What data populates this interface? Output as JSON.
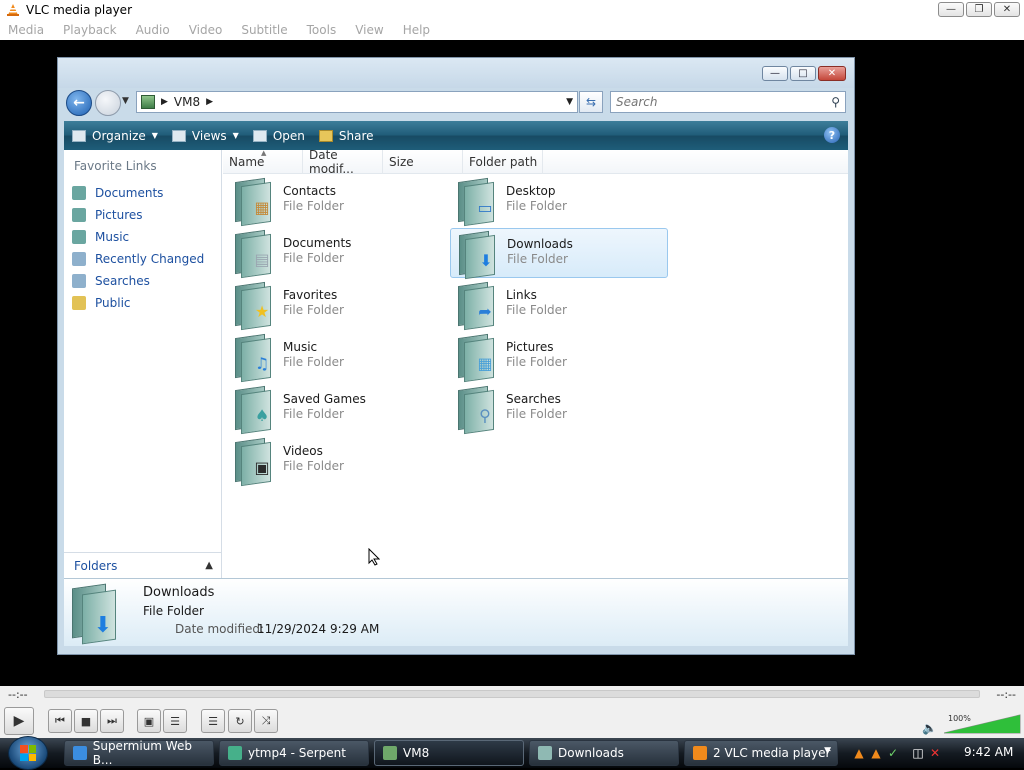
{
  "vlc": {
    "title": "VLC media player",
    "menu": [
      "Media",
      "Playback",
      "Audio",
      "Video",
      "Subtitle",
      "Tools",
      "View",
      "Help"
    ],
    "time_elapsed": "--:--",
    "time_total": "--:--",
    "volume": "100%",
    "volume_level": 1.0
  },
  "explorer": {
    "address": {
      "path_label": "VM8"
    },
    "search": {
      "placeholder": "Search"
    },
    "toolbar": {
      "organize": "Organize",
      "views": "Views",
      "open": "Open",
      "share": "Share",
      "help": "?"
    },
    "nav": {
      "favorite_links_header": "Favorite Links",
      "items": [
        {
          "label": "Documents",
          "icon": "documents-icon",
          "color": "#6aa6a0"
        },
        {
          "label": "Pictures",
          "icon": "pictures-icon",
          "color": "#6aa6a0"
        },
        {
          "label": "Music",
          "icon": "music-icon",
          "color": "#6aa6a0"
        },
        {
          "label": "Recently Changed",
          "icon": "recent-icon",
          "color": "#8eb0cc"
        },
        {
          "label": "Searches",
          "icon": "searches-icon",
          "color": "#8eb0cc"
        },
        {
          "label": "Public",
          "icon": "public-folder-icon",
          "color": "#e2c256"
        }
      ],
      "folders_label": "Folders"
    },
    "columns": [
      "Name",
      "Date modif...",
      "Size",
      "Folder path"
    ],
    "files": [
      {
        "name": "Contacts",
        "type": "File Folder",
        "badge": "contacts-icon"
      },
      {
        "name": "Desktop",
        "type": "File Folder",
        "badge": "desktop-icon"
      },
      {
        "name": "Documents",
        "type": "File Folder",
        "badge": "documents-icon"
      },
      {
        "name": "Downloads",
        "type": "File Folder",
        "badge": "downloads-icon"
      },
      {
        "name": "Favorites",
        "type": "File Folder",
        "badge": "favorites-star-icon"
      },
      {
        "name": "Links",
        "type": "File Folder",
        "badge": "links-icon"
      },
      {
        "name": "Music",
        "type": "File Folder",
        "badge": "music-icon"
      },
      {
        "name": "Pictures",
        "type": "File Folder",
        "badge": "pictures-icon"
      },
      {
        "name": "Saved Games",
        "type": "File Folder",
        "badge": "saved-games-icon"
      },
      {
        "name": "Searches",
        "type": "File Folder",
        "badge": "searches-icon"
      },
      {
        "name": "Videos",
        "type": "File Folder",
        "badge": "videos-icon"
      }
    ],
    "selected": "Downloads",
    "details": {
      "name": "Downloads",
      "type": "File Folder",
      "date_label": "Date modified:",
      "date_value": "11/29/2024 9:29 AM"
    }
  },
  "taskbar": {
    "tasks": [
      {
        "label": "Supermium Web B...",
        "icon": "browser-icon",
        "color": "#3b8de0"
      },
      {
        "label": "ytmp4 - Serpent",
        "icon": "serpent-icon",
        "color": "#46b08a"
      },
      {
        "label": "VM8",
        "icon": "vm-folder-icon",
        "color": "#6fa86a"
      },
      {
        "label": "Downloads",
        "icon": "downloads-folder-icon",
        "color": "#8fb9b3"
      },
      {
        "label": "2  VLC media player",
        "icon": "vlc-icon",
        "color": "#f08a1c"
      }
    ],
    "clock": "9:42 AM"
  }
}
